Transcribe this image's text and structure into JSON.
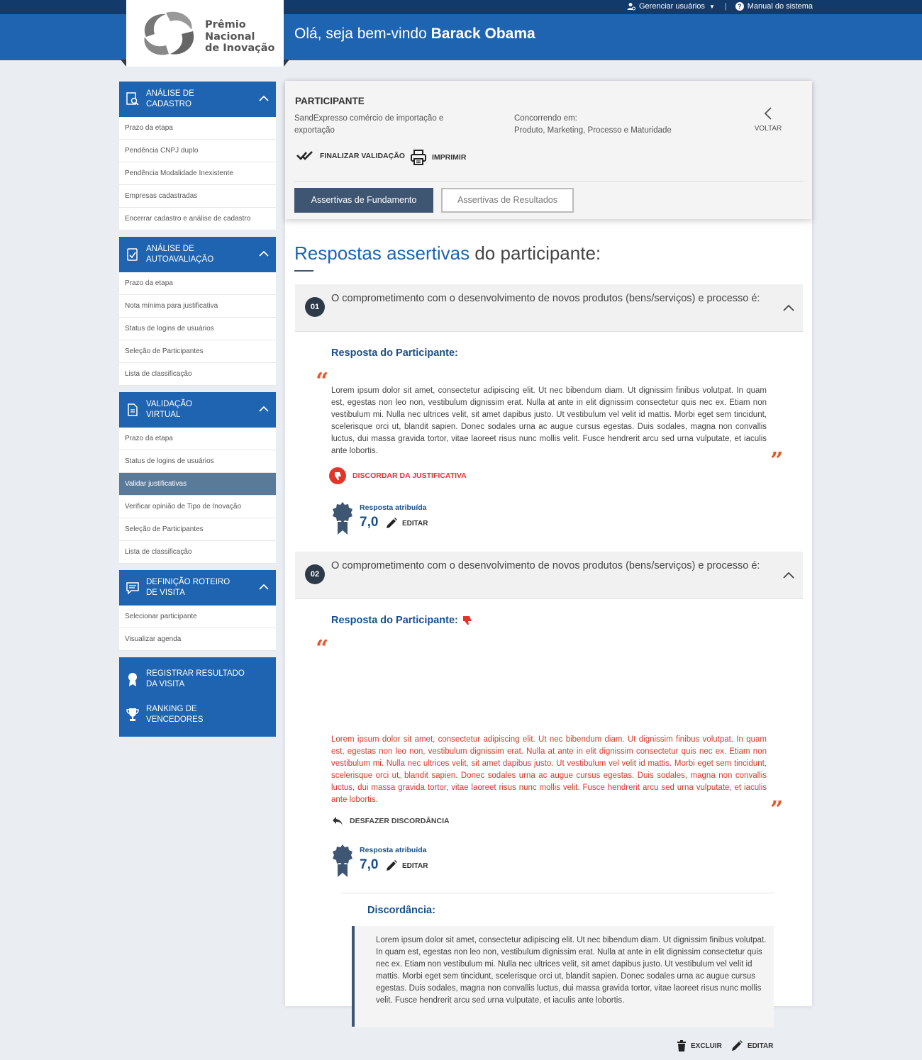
{
  "header": {
    "manage_users": "Gerenciar usuários",
    "manual": "Manual do sistema",
    "welcome_prefix": "Olá, seja bem-vindo",
    "user_name": "Barack Obama",
    "logo_line1": "Prêmio",
    "logo_line2": "Nacional",
    "logo_line3": "de Inovação"
  },
  "sidebar": {
    "sections": [
      {
        "title_line1": "ANÁLISE DE",
        "title_line2": "CADASTRO",
        "icon": "search-doc-icon",
        "items": [
          "Prazo da etapa",
          "Pendência CNPJ duplo",
          "Pendência Modalidade Inexistente",
          "Empresas cadastradas",
          "Encerrar cadastro e análise de cadastro"
        ]
      },
      {
        "title_line1": "ANÁLISE DE",
        "title_line2": "AUTOAVALIAÇÃO",
        "icon": "check-doc-icon",
        "items": [
          "Prazo da etapa",
          "Nota mínima para justificativa",
          "Status de logins de usuários",
          "Seleção de Participantes",
          "Lista de classificação"
        ]
      },
      {
        "title_line1": "VALIDAÇÃO",
        "title_line2": "VIRTUAL",
        "icon": "document-icon",
        "items": [
          "Prazo da etapa",
          "Status de logins de usuários",
          "Validar justificativas",
          "Verificar opinião de Tipo de Inovação",
          "Seleção de Participantes",
          "Lista de classificação"
        ]
      },
      {
        "title_line1": "DEFINIÇÃO ROTEIRO",
        "title_line2": "DE VISITA",
        "icon": "chat-icon",
        "items": [
          "Selecionar participante",
          "Visualizar agenda"
        ]
      }
    ],
    "bottom": [
      {
        "line1": "REGISTRAR RESULTADO",
        "line2": "DA VISITA",
        "icon": "medal-icon"
      },
      {
        "line1": "RANKING DE",
        "line2": "VENCEDORES",
        "icon": "trophy-icon"
      }
    ]
  },
  "participant": {
    "section_title": "PARTICIPANTE",
    "name": "SandExpresso comércio de importação e exportação",
    "competing_label": "Concorrendo em:",
    "competing_value": "Produto, Marketing, Processo e Maturidade",
    "back": "VOLTAR",
    "finalize": "FINALIZAR VALIDAÇÃO",
    "print": "IMPRIMIR",
    "tab_active": "Assertivas de Fundamento",
    "tab_inactive": "Assertivas de Resultados"
  },
  "responses": {
    "title_blue": "Respostas assertivas",
    "title_rest": "do participante:",
    "answer_label": "Resposta do Participante:",
    "score_label": "Resposta atribuída",
    "edit": "EDITAR",
    "questions": [
      {
        "number": "01",
        "text": "O comprometimento com o desenvolvimento de novos produtos (bens/serviços) e processo é:",
        "answer": "Lorem ipsum dolor sit amet, consectetur adipiscing elit. Ut nec bibendum diam. Ut dignissim finibus volutpat. In quam est, egestas non leo non, vestibulum dignissim erat. Nulla at ante in elit dignissim consectetur quis nec ex. Etiam non vestibulum mi. Nulla nec ultrices velit, sit amet dapibus justo. Ut vestibulum vel velit id mattis. Morbi eget sem tincidunt, scelerisque orci ut, blandit sapien. Donec sodales urna ac augue cursus egestas. Duis sodales, magna non convallis luctus, dui massa gravida tortor, vitae laoreet risus nunc mollis velit. Fusce hendrerit arcu sed urna vulputate, et iaculis ante lobortis.",
        "action": "DISCORDAR DA JUSTIFICATIVA",
        "score": "7,0"
      },
      {
        "number": "02",
        "text": "O comprometimento com o desenvolvimento de novos produtos (bens/serviços) e processo é:",
        "answer": "Lorem ipsum dolor sit amet, consectetur adipiscing elit. Ut nec bibendum diam. Ut dignissim finibus volutpat. In quam est, egestas non leo non, vestibulum dignissim erat. Nulla at ante in elit dignissim consectetur quis nec ex. Etiam non vestibulum mi. Nulla nec ultrices velit, sit amet dapibus justo. Ut vestibulum vel velit id mattis. Morbi eget sem tincidunt, scelerisque orci ut, blandit sapien. Donec sodales urna ac augue cursus egestas. Duis sodales, magna non convallis luctus, dui massa gravida tortor, vitae laoreet risus nunc mollis velit. Fusce hendrerit arcu sed urna vulputate, et iaculis ante lobortis.",
        "action": "DESFAZER DISCORDÂNCIA",
        "score": "7,0",
        "disagreement_title": "Discordância:",
        "disagreement_text": "Lorem ipsum dolor sit amet, consectetur adipiscing elit. Ut nec bibendum diam. Ut dignissim finibus volutpat. In quam est, egestas non leo non, vestibulum dignissim erat. Nulla at ante in elit dignissim consectetur quis nec ex. Etiam non vestibulum mi. Nulla nec ultrices velit, sit amet dapibus justo. Ut vestibulum vel velit id mattis. Morbi eget sem tincidunt, scelerisque orci ut, blandit sapien. Donec sodales urna ac augue cursus egestas. Duis sodales, magna non convallis luctus, dui massa gravida tortor, vitae laoreet risus nunc mollis velit. Fusce hendrerit arcu sed urna vulputate, et iaculis ante lobortis.",
        "delete": "EXCLUIR",
        "edit": "EDITAR"
      }
    ]
  },
  "colors": {
    "primary": "#1e64b0",
    "dark_navy": "#123a6b",
    "accent_red": "#e0362a",
    "quote_orange": "#e55a2d",
    "active_item": "#5a7a9a"
  }
}
